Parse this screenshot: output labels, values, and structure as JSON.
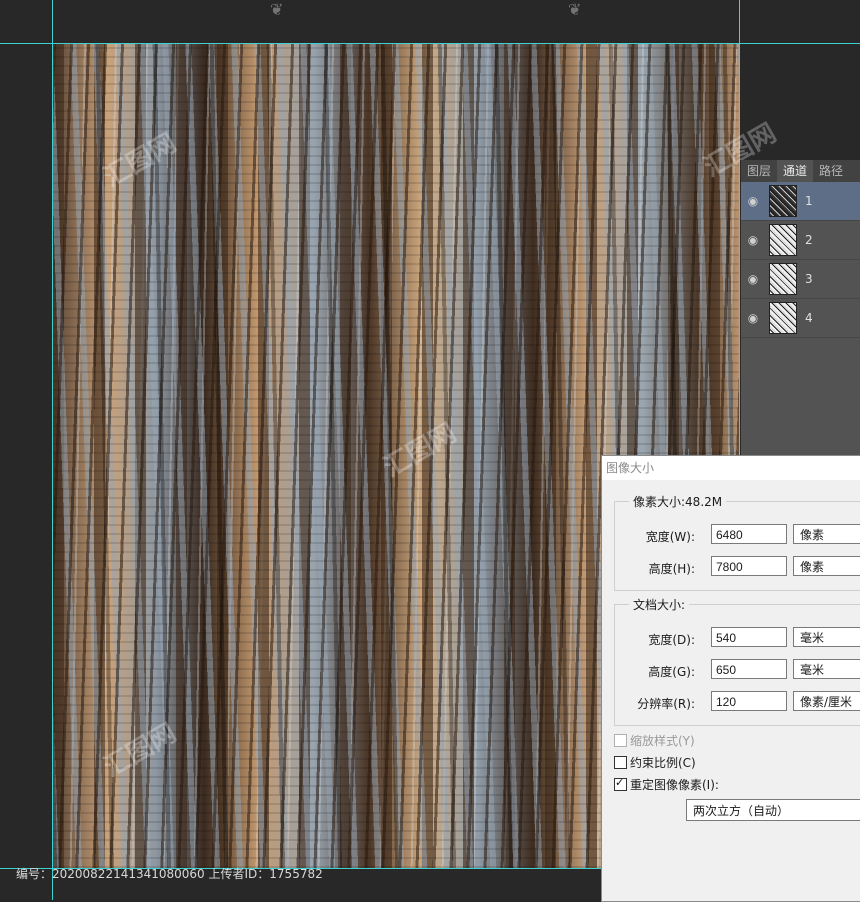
{
  "panel": {
    "tabs": [
      "图层",
      "通道",
      "路径"
    ],
    "active_tab": "通道",
    "channels": [
      {
        "name": "1",
        "selected": true
      },
      {
        "name": "2",
        "selected": false
      },
      {
        "name": "3",
        "selected": false
      },
      {
        "name": "4",
        "selected": false
      }
    ]
  },
  "dialog": {
    "title": "图像大小",
    "pixel_size_legend": "像素大小:48.2M",
    "width_label": "宽度(W):",
    "width_value": "6480",
    "width_unit": "像素",
    "height_label": "高度(H):",
    "height_value": "7800",
    "height_unit": "像素",
    "doc_size_legend": "文档大小:",
    "doc_width_label": "宽度(D):",
    "doc_width_value": "540",
    "doc_width_unit": "毫米",
    "doc_height_label": "高度(G):",
    "doc_height_value": "650",
    "doc_height_unit": "毫米",
    "resolution_label": "分辨率(R):",
    "resolution_value": "120",
    "resolution_unit": "像素/厘米",
    "scale_styles_label": "缩放样式(Y)",
    "constrain_label": "约束比例(C)",
    "resample_label": "重定图像像素(I):",
    "resample_method": "两次立方（自动）"
  },
  "footer": {
    "text": "编号：20200822141341080060 上传者ID：1755782"
  },
  "watermark_text": "汇图网"
}
